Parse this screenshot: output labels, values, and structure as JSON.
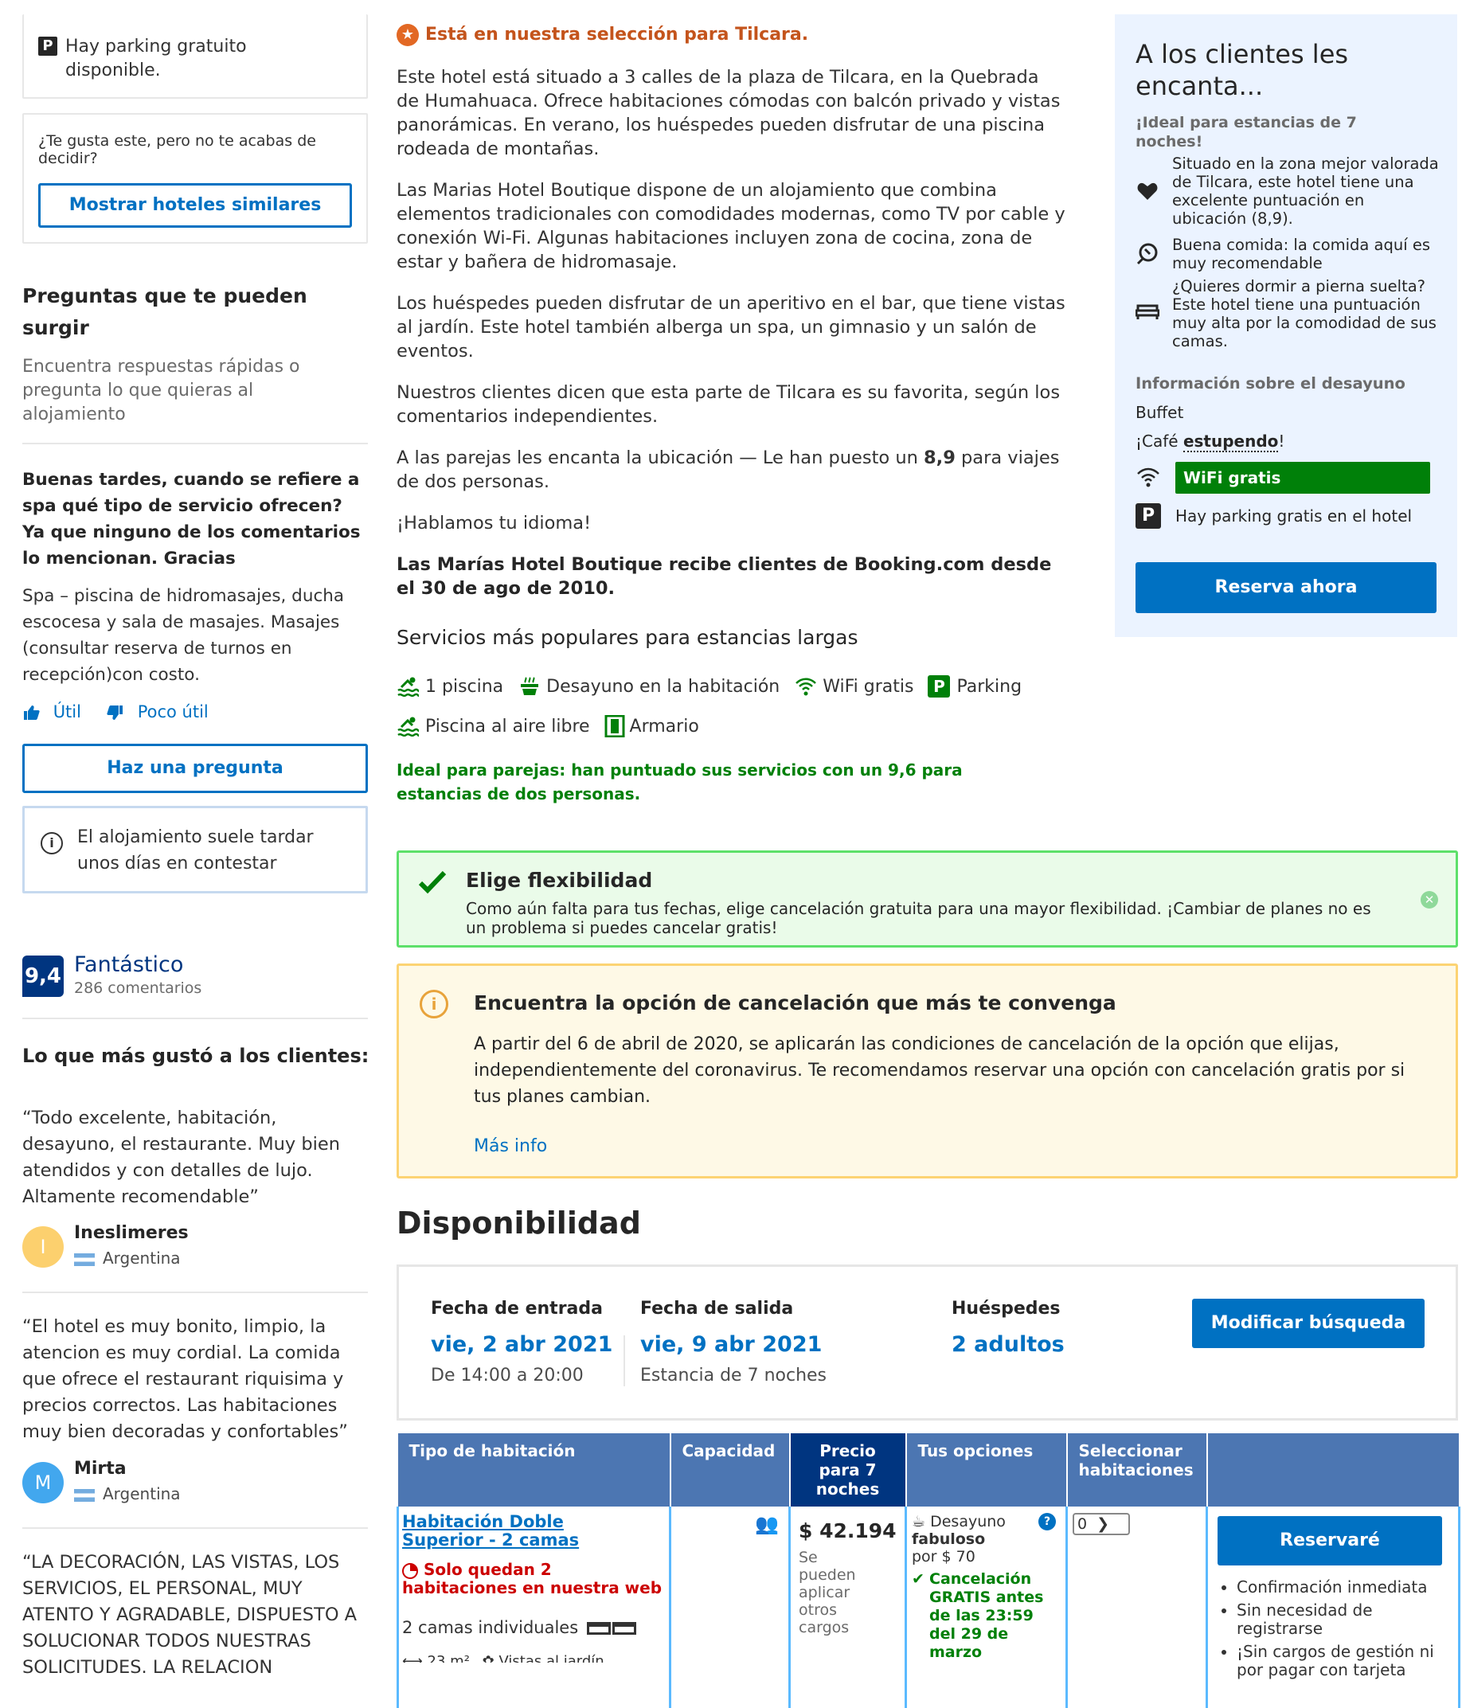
{
  "left": {
    "parking_text": "Hay parking gratuito disponible.",
    "similar_prompt": "¿Te gusta este, pero no te acabas de decidir?",
    "similar_button": "Mostrar hoteles similares",
    "qa_title": "Preguntas que te pueden surgir",
    "qa_subtitle": "Encuentra respuestas rápidas o pregunta lo que quieras al alojamiento",
    "question": "Buenas tardes, cuando se refiere a spa qué tipo de servicio ofrecen? Ya que ninguno de los comentarios lo mencionan. Gracias",
    "answer": "Spa – piscina de hidromasajes, ducha escocesa y sala de masajes. Masajes (consultar reserva de turnos en recepción)con costo.",
    "useful": "Útil",
    "not_useful": "Poco útil",
    "ask_button": "Haz una pregunta",
    "response_note": "El alojamiento suele tardar unos días en contestar",
    "score": "9,4",
    "score_word": "Fantástico",
    "review_count": "286 comentarios",
    "liked_title": "Lo que más gustó a los clientes:",
    "reviews": [
      {
        "text": "“Todo excelente, habitación, desayuno, el restaurante. Muy bien atendidos y con detalles de lujo. Altamente recomendable”",
        "initial": "I",
        "name": "Ineslimeres",
        "country": "Argentina",
        "color": "#fcd06e"
      },
      {
        "text": "“El hotel es muy bonito, limpio, la atencion es muy cordial. La comida que ofrece el restaurant riquisima y precios correctos. Las habitaciones muy bien decoradas y confortables”",
        "initial": "M",
        "name": "Mirta",
        "country": "Argentina",
        "color": "#42a7ee"
      },
      {
        "text": "“LA DECORACIÓN, LAS VISTAS, LOS SERVICIOS, EL PERSONAL, MUY ATENTO Y AGRADABLE, DISPUESTO A SOLUCIONAR TODOS NUESTRAS SOLICITUDES. LA RELACION"
      }
    ]
  },
  "mid": {
    "selection": "Está en nuestra selección para Tilcara.",
    "p1": "Este hotel está situado a 3 calles de la plaza de Tilcara, en la Quebrada de Humahuaca. Ofrece habitaciones cómodas con balcón privado y vistas panorámicas. En verano, los huéspedes pueden disfrutar de una piscina rodeada de montañas.",
    "p2": "Las Marias Hotel Boutique dispone de un alojamiento que combina elementos tradicionales con comodidades modernas, como TV por cable y conexión Wi-Fi. Algunas habitaciones incluyen zona de cocina, zona de estar y bañera de hidromasaje.",
    "p3": "Los huéspedes pueden disfrutar de un aperitivo en el bar, que tiene vistas al jardín. Este hotel también alberga un spa, un gimnasio y un salón de eventos.",
    "p4": "Nuestros clientes dicen que esta parte de Tilcara es su favorita, según los comentarios independientes.",
    "p5_pre": "A las parejas les encanta la ubicación — Le han puesto un ",
    "p5_score": "8,9",
    "p5_post": " para viajes de dos personas.",
    "p6": "¡Hablamos tu idioma!",
    "p7": "Las Marías Hotel Boutique recibe clientes de Booking.com desde el 30 de ago de 2010.",
    "popular_title": "Servicios más populares para estancias largas",
    "facilities": [
      "1 piscina",
      "Desayuno en la habitación",
      "WiFi gratis",
      "Parking",
      "Piscina al aire libre",
      "Armario"
    ],
    "couples": "Ideal para parejas: han puntuado sus servicios con un 9,6 para estancias de dos personas.",
    "flex_title": "Elige flexibilidad",
    "flex_text": "Como aún falta para tus fechas, elige cancelación gratuita para una mayor flexibilidad. ¡Cambiar de planes no es un problema si puedes cancelar gratis!",
    "cancel_title": "Encuentra la opción de cancelación que más te convenga",
    "cancel_text": "A partir del 6 de abril de 2020, se aplicarán las condiciones de cancelación de la opción que elijas, independientemente del coronavirus. Te recomendamos reservar una opción con cancelación gratis por si tus planes cambian.",
    "more_info": "Más info",
    "availability": "Disponibilidad",
    "checkin_label": "Fecha de entrada",
    "checkin_date": "vie, 2 abr 2021",
    "checkin_time": "De 14:00 a 20:00",
    "checkout_label": "Fecha de salida",
    "checkout_date": "vie, 9 abr 2021",
    "stay_length": "Estancia de 7 noches",
    "guests_label": "Huéspedes",
    "guests_value": "2 adultos",
    "modify_button": "Modificar búsqueda"
  },
  "table": {
    "headers": [
      "Tipo de habitación",
      "Capacidad",
      "Precio para 7 noches",
      "Tus opciones",
      "Seleccionar habitaciones",
      ""
    ],
    "room_name": "Habitación Doble Superior - 2 camas",
    "scarcity": "Solo quedan 2 habitaciones en nuestra web",
    "beds": "2 camas individuales",
    "size": "23 m²",
    "view": "Vistas al jardín",
    "price": "$ 42.194",
    "price_note": "Se pueden aplicar otros cargos",
    "opt_breakfast_pre": "Desayuno",
    "opt_breakfast_bold": "fabuloso",
    "opt_breakfast_price": "por $ 70",
    "opt_cancel": "Cancelación GRATIS antes de las 23:59 del 29 de marzo",
    "select_value": "0",
    "reserve_button": "Reservaré",
    "bullets": [
      "Confirmación inmediata",
      "Sin necesidad de registrarse",
      "¡Sin cargos de gestión ni por pagar con tarjeta"
    ]
  },
  "right": {
    "title": "A los clientes les encanta...",
    "ideal": "¡Ideal para estancias de 7 noches!",
    "loc": "Situado en la zona mejor valorada de Tilcara, este hotel tiene una excelente puntuación en ubicación (8,9).",
    "food": "Buena comida: la comida aquí es muy recomendable",
    "sleep": "¿Quieres dormir a pierna suelta? Este hotel tiene una puntuación muy alta por la comodidad de sus camas.",
    "breakfast_title": "Información sobre el desayuno",
    "breakfast_type": "Buffet",
    "coffee_pre": "¡Café ",
    "coffee_word": "estupendo",
    "coffee_post": "!",
    "wifi": "WiFi gratis",
    "parking": "Hay parking gratis en el hotel",
    "reserve": "Reserva ahora"
  }
}
